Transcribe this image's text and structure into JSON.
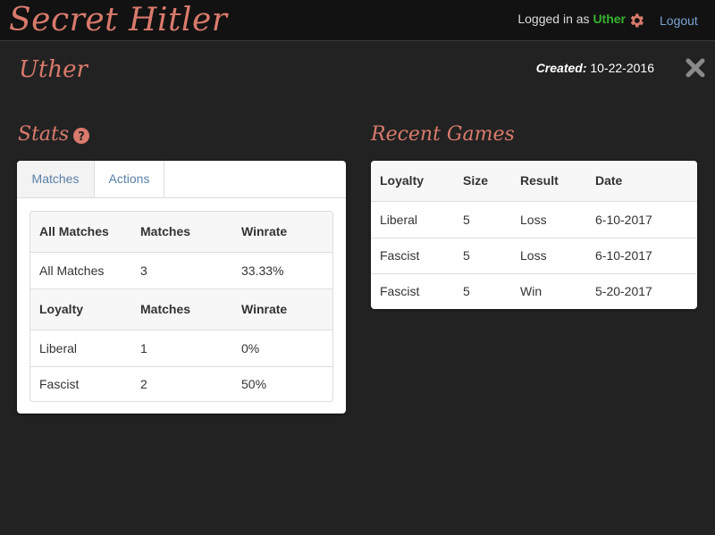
{
  "app": {
    "brand": "Secret Hitler",
    "logged_in_prefix": "Logged in as",
    "username": "Uther",
    "logout_label": "Logout"
  },
  "profile": {
    "name": "Uther",
    "created_label": "Created:",
    "created_value": "10-22-2016"
  },
  "stats": {
    "title": "Stats",
    "tabs": [
      "Matches",
      "Actions"
    ],
    "all_header": [
      "All Matches",
      "Matches",
      "Winrate"
    ],
    "all_row": [
      "All Matches",
      "3",
      "33.33%"
    ],
    "loyalty_header": [
      "Loyalty",
      "Matches",
      "Winrate"
    ],
    "loyalty_rows": [
      [
        "Liberal",
        "1",
        "0%"
      ],
      [
        "Fascist",
        "2",
        "50%"
      ]
    ]
  },
  "recent": {
    "title": "Recent Games",
    "headers": [
      "Loyalty",
      "Size",
      "Result",
      "Date"
    ],
    "rows": [
      [
        "Liberal",
        "5",
        "Loss",
        "6-10-2017"
      ],
      [
        "Fascist",
        "5",
        "Loss",
        "6-10-2017"
      ],
      [
        "Fascist",
        "5",
        "Win",
        "5-20-2017"
      ]
    ]
  },
  "colors": {
    "accent": "#d97a6c",
    "username": "#38b32f",
    "link": "#7aa3d4",
    "background": "#222222"
  },
  "icons": [
    "gear-icon",
    "close-icon",
    "help-icon"
  ]
}
